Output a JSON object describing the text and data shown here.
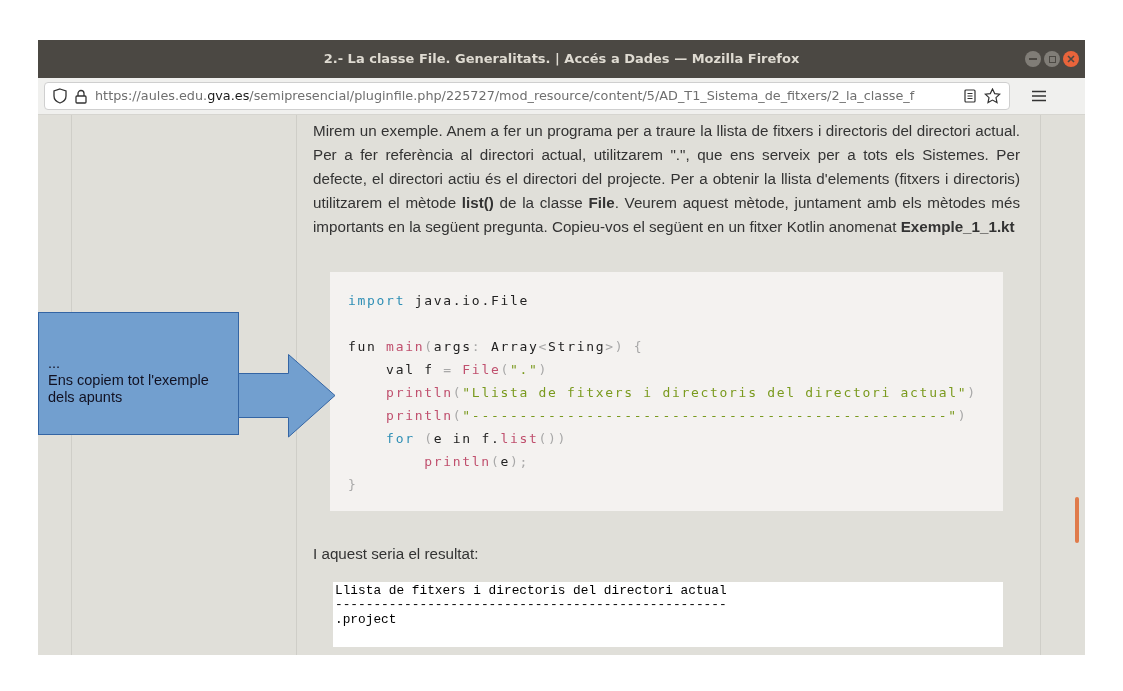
{
  "window": {
    "title": "2.- La classe File. Generalitats. | Accés a Dades — Mozilla Firefox"
  },
  "address_bar": {
    "url_prefix": "https://aules.edu.",
    "url_domain": "gva.es",
    "url_path": "/semipresencial/pluginfile.php/225727/mod_resource/content/5/AD_T1_Sistema_de_fitxers/2_la_classe_f"
  },
  "content": {
    "paragraph": "Mirem un exemple. Anem a fer un programa per a traure la llista de fitxers i directoris del directori actual. Per a fer referència al directori actual, utilitzarem \".\", que ens serveix per a tots els Sistemes. Per defecte, el directori actiu és el directori del projecte. Per a obtenir la llista d'elements (fitxers i directoris) utilitzarem el mètode **list()** de la classe **File**. Veurem aquest mètode, juntament amb els mètodes més importants en la següent pregunta. Copieu-vos el següent en un fitxer Kotlin anomenat **Exemple_1_1.kt**",
    "code_lines": [
      [
        {
          "kind": "keyword",
          "text": "import"
        },
        {
          "kind": "plain",
          "text": " java.io.File"
        }
      ],
      [
        {
          "kind": "plain",
          "text": "fun "
        },
        {
          "kind": "func",
          "text": "main"
        },
        {
          "kind": "punct",
          "text": "("
        },
        {
          "kind": "plain",
          "text": "args"
        },
        {
          "kind": "punct",
          "text": ": "
        },
        {
          "kind": "plain",
          "text": "Array"
        },
        {
          "kind": "punct",
          "text": "<"
        },
        {
          "kind": "plain",
          "text": "String"
        },
        {
          "kind": "punct",
          "text": ">) {"
        }
      ],
      [
        {
          "kind": "plain",
          "text": "    val f "
        },
        {
          "kind": "punct",
          "text": "= "
        },
        {
          "kind": "func",
          "text": "File"
        },
        {
          "kind": "punct",
          "text": "("
        },
        {
          "kind": "string",
          "text": "\".\""
        },
        {
          "kind": "punct",
          "text": ")"
        }
      ],
      [
        {
          "kind": "func",
          "text": "    println"
        },
        {
          "kind": "punct",
          "text": "("
        },
        {
          "kind": "string",
          "text": "\"Llista de fitxers i directoris del directori actual\""
        },
        {
          "kind": "punct",
          "text": ")"
        }
      ],
      [
        {
          "kind": "func",
          "text": "    println"
        },
        {
          "kind": "punct",
          "text": "("
        },
        {
          "kind": "string",
          "text": "\"--------------------------------------------------\""
        },
        {
          "kind": "punct",
          "text": ")"
        }
      ],
      [
        {
          "kind": "keyword",
          "text": "    for "
        },
        {
          "kind": "punct",
          "text": "("
        },
        {
          "kind": "plain",
          "text": "e in f."
        },
        {
          "kind": "func",
          "text": "list"
        },
        {
          "kind": "punct",
          "text": "())"
        }
      ],
      [
        {
          "kind": "func",
          "text": "        println"
        },
        {
          "kind": "punct",
          "text": "("
        },
        {
          "kind": "plain",
          "text": "e"
        },
        {
          "kind": "punct",
          "text": ");"
        }
      ],
      [
        {
          "kind": "punct",
          "text": "}"
        }
      ]
    ],
    "result_intro": "I aquest seria el resultat:",
    "output_lines": [
      "Llista de fitxers i directoris del directori actual",
      "---------------------------------------------------",
      ".project"
    ]
  },
  "callout": {
    "lines": [
      "...",
      "Ens copiem tot l'exemple",
      "dels apunts"
    ]
  }
}
